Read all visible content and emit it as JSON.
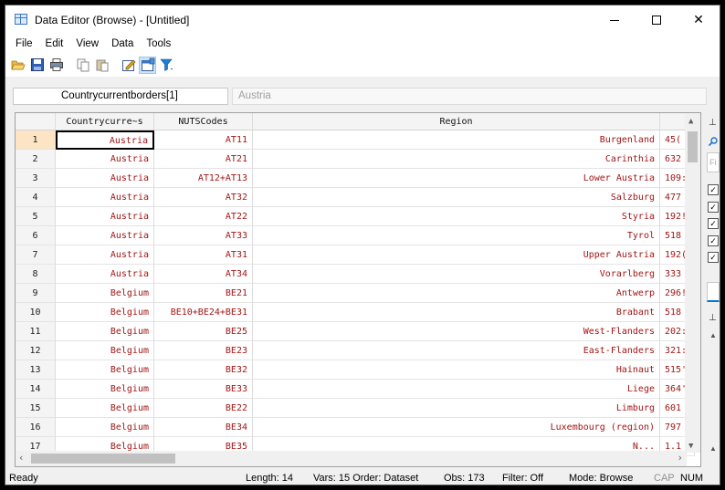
{
  "window": {
    "title": "Data Editor (Browse) - [Untitled]",
    "min_glyph": "—",
    "close_glyph": "✕"
  },
  "menu": [
    "File",
    "Edit",
    "View",
    "Data",
    "Tools"
  ],
  "toolbar": {
    "icons": [
      "open-icon",
      "save-icon",
      "print-icon",
      "copy-icon",
      "paste-icon",
      "edit-mode-icon",
      "browse-mode-icon",
      "filter-icon"
    ]
  },
  "varbar": {
    "name": "Countrycurrentborders[1]",
    "value": "Austria"
  },
  "grid": {
    "headers": {
      "country": "Countrycurre~s",
      "nuts": "NUTSCodes",
      "region": "Region"
    },
    "rows": [
      {
        "n": "1",
        "country": "Austria",
        "nuts": "AT11",
        "region": "Burgenland",
        "num": "45("
      },
      {
        "n": "2",
        "country": "Austria",
        "nuts": "AT21",
        "region": "Carinthia",
        "num": "632"
      },
      {
        "n": "3",
        "country": "Austria",
        "nuts": "AT12+AT13",
        "region": "Lower Austria",
        "num": "109:"
      },
      {
        "n": "4",
        "country": "Austria",
        "nuts": "AT32",
        "region": "Salzburg",
        "num": "477"
      },
      {
        "n": "5",
        "country": "Austria",
        "nuts": "AT22",
        "region": "Styria",
        "num": "192!"
      },
      {
        "n": "6",
        "country": "Austria",
        "nuts": "AT33",
        "region": "Tyrol",
        "num": "518"
      },
      {
        "n": "7",
        "country": "Austria",
        "nuts": "AT31",
        "region": "Upper Austria",
        "num": "192("
      },
      {
        "n": "8",
        "country": "Austria",
        "nuts": "AT34",
        "region": "Vorarlberg",
        "num": "333"
      },
      {
        "n": "9",
        "country": "Belgium",
        "nuts": "BE21",
        "region": "Antwerp",
        "num": "296!"
      },
      {
        "n": "10",
        "country": "Belgium",
        "nuts": "BE10+BE24+BE31",
        "region": "Brabant",
        "num": "518"
      },
      {
        "n": "11",
        "country": "Belgium",
        "nuts": "BE25",
        "region": "West-Flanders",
        "num": "202:"
      },
      {
        "n": "12",
        "country": "Belgium",
        "nuts": "BE23",
        "region": "East-Flanders",
        "num": "321:"
      },
      {
        "n": "13",
        "country": "Belgium",
        "nuts": "BE32",
        "region": "Hainaut",
        "num": "515'"
      },
      {
        "n": "14",
        "country": "Belgium",
        "nuts": "BE33",
        "region": "Liege",
        "num": "364'"
      },
      {
        "n": "15",
        "country": "Belgium",
        "nuts": "BE22",
        "region": "Limburg",
        "num": "601"
      },
      {
        "n": "16",
        "country": "Belgium",
        "nuts": "BE34",
        "region": "Luxembourg (region)",
        "num": "797"
      },
      {
        "n": "17",
        "country": "Belgium",
        "nuts": "BE35",
        "region": "N...",
        "num": "1.1"
      }
    ]
  },
  "statusbar": {
    "ready": "Ready",
    "length": "Length: 14",
    "vars": "Vars: 15  Order: Dataset",
    "obs": "Obs: 173",
    "filter": "Filter: Off",
    "mode": "Mode: Browse",
    "caps": "CAP",
    "num": "NUM"
  }
}
